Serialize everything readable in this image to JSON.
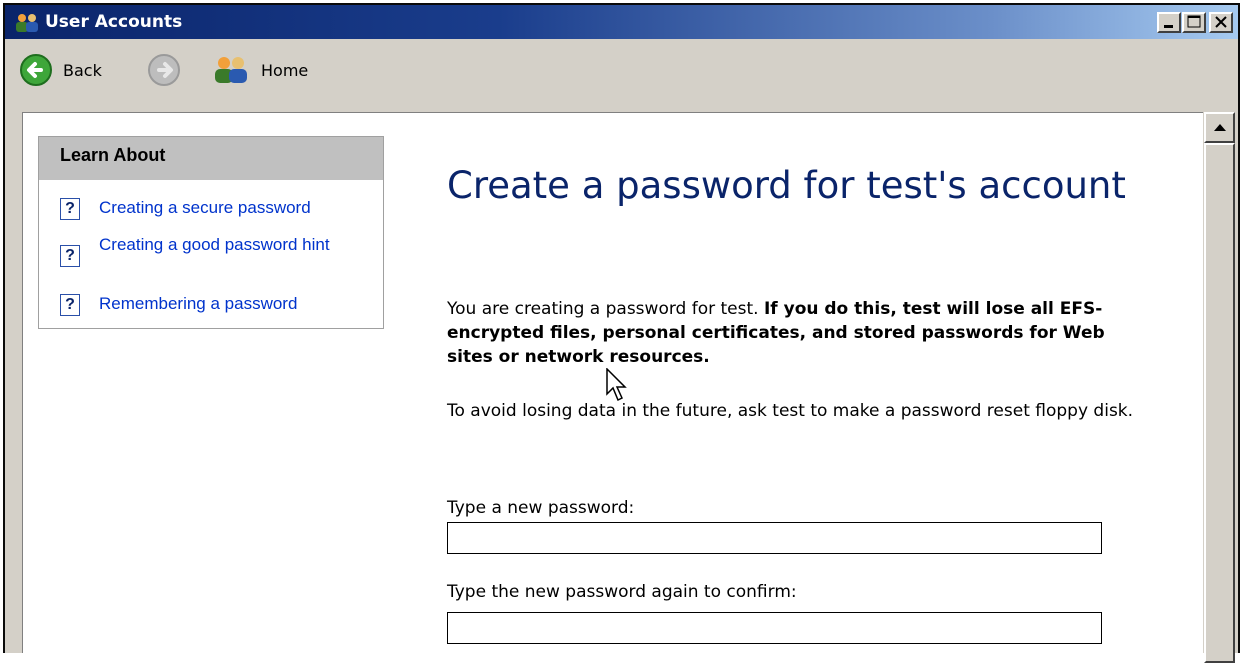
{
  "window": {
    "title": "User Accounts",
    "controls": [
      "minimize",
      "maximize",
      "close"
    ]
  },
  "toolbar": {
    "back_label": "Back",
    "forward_label": "",
    "home_label": "Home"
  },
  "sidebar": {
    "heading": "Learn About",
    "items": [
      {
        "icon": "help-icon",
        "label": "Creating a secure password"
      },
      {
        "icon": "help-icon",
        "label": "Creating a good password hint"
      },
      {
        "icon": "help-icon",
        "label": "Remembering a password"
      }
    ]
  },
  "main": {
    "title": "Create a password for test's account",
    "warning_intro": "You are creating a password for test.",
    "warning_bold": "If you do this, test will lose all EFS-encrypted files, personal certificates, and stored passwords for Web sites or network resources.",
    "advice": "To avoid losing data in the future, ask test to make a password reset floppy disk.",
    "new_password_label": "Type a new password:",
    "new_password_value": "",
    "confirm_password_label": "Type the new password again to confirm:",
    "confirm_password_value": ""
  },
  "colors": {
    "title_blue": "#0a246a",
    "link_blue": "#0033cc",
    "chrome_gray": "#d4d0c8"
  }
}
